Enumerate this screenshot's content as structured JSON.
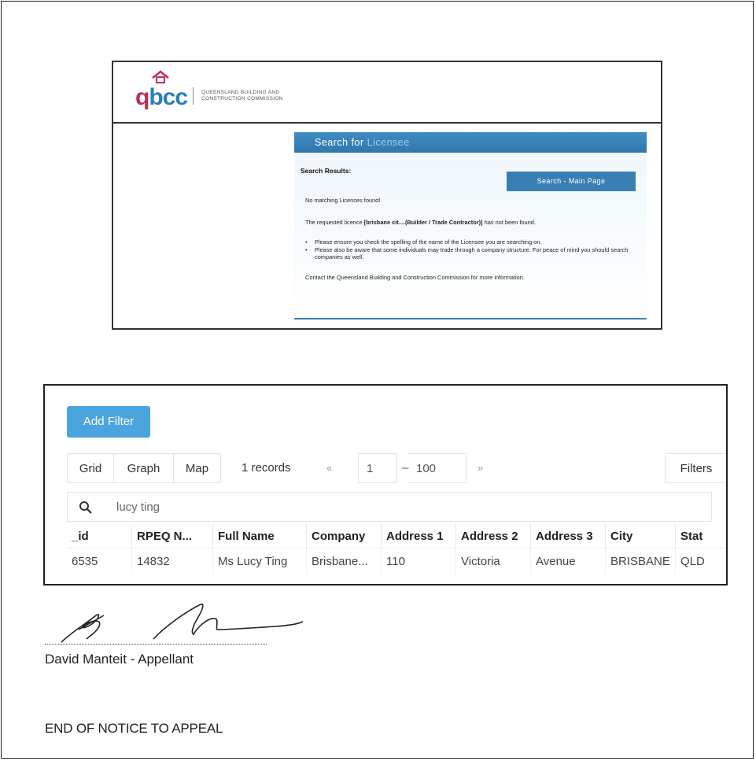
{
  "qbcc": {
    "logo_text": "qbcc",
    "tagline": "QUEENSLAND BUILDING AND CONSTRUCTION COMMISSION",
    "panel_title_a": "Search for",
    "panel_title_b": "Licensee",
    "results_label": "Search Results:",
    "main_page_button": "Search - Main Page",
    "no_match": "No matching Licences found!",
    "requested_prefix": "The requested licence",
    "requested_bold": "[brisbane cit....(Builder / Trade Contractor)]",
    "requested_suffix": "has not been found.",
    "bullets": [
      "Please ensure you check the spelling of the name of the Licensee you are searching on.",
      "Please also be aware that some individuals may trade through a company structure. For peace of mind you should search companies as well."
    ],
    "contact": "Contact the Queensland Building and Construction Commission for more information."
  },
  "grid": {
    "add_filter": "Add Filter",
    "view_grid": "Grid",
    "view_graph": "Graph",
    "view_map": "Map",
    "records": "1 records",
    "prev": "«",
    "page_from": "1",
    "dash": "–",
    "page_to": "100",
    "next": "»",
    "filters": "Filters",
    "search_value": "lucy ting",
    "columns": [
      "_id",
      "RPEQ N...",
      "Full Name",
      "Company",
      "Address 1",
      "Address 2",
      "Address 3",
      "City",
      "Stat"
    ],
    "rows": [
      [
        "6535",
        "14832",
        "Ms Lucy Ting",
        "Brisbane...",
        "110",
        "Victoria",
        "Avenue",
        "BRISBANE",
        "QLD"
      ]
    ]
  },
  "footer": {
    "signer": "David Manteit - Appellant",
    "end_notice": "END OF NOTICE TO APPEAL"
  },
  "colors": {
    "qbcc_blue": "#2f78ad",
    "add_filter_blue": "#4aa5de",
    "logo_pink": "#c22d55"
  }
}
